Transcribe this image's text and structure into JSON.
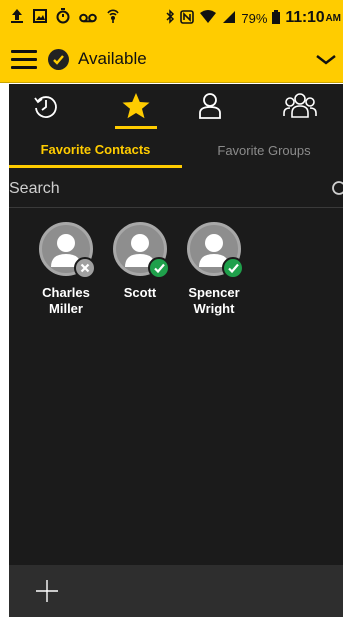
{
  "status_bar": {
    "time": "11:10",
    "ampm": "AM",
    "battery": "79%"
  },
  "app_bar": {
    "presence_label": "Available"
  },
  "icon_tabs": [
    {
      "icon": "recent-icon",
      "active": false
    },
    {
      "icon": "star-icon",
      "active": true
    },
    {
      "icon": "contact-icon",
      "active": false
    },
    {
      "icon": "group-icon",
      "active": false
    }
  ],
  "tabs": {
    "favorite_contacts": "Favorite Contacts",
    "favorite_groups": "Favorite Groups"
  },
  "search": {
    "placeholder": "Search"
  },
  "contacts": [
    {
      "name": "Charles\nMiller",
      "status": "offline"
    },
    {
      "name": "Scott",
      "status": "available"
    },
    {
      "name": "Spencer\nWright",
      "status": "available"
    }
  ],
  "colors": {
    "accent": "#ffcc00",
    "background": "#1b1b1b",
    "available": "#1fa04b",
    "offline": "#a0a0a0"
  }
}
